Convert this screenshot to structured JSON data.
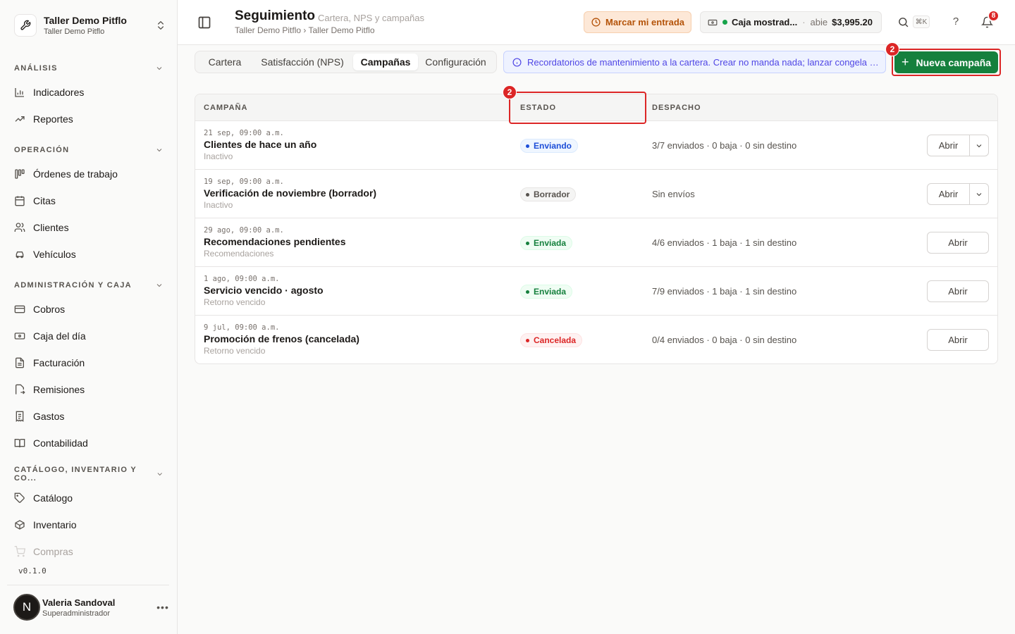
{
  "org": {
    "name": "Taller Demo Pitflo",
    "sub": "Taller Demo Pitflo"
  },
  "sidebar": {
    "sections": [
      {
        "title": "ANÁLISIS",
        "items": [
          {
            "label": "Indicadores",
            "icon": "bar-chart-icon"
          },
          {
            "label": "Reportes",
            "icon": "trend-icon"
          }
        ]
      },
      {
        "title": "OPERACIÓN",
        "items": [
          {
            "label": "Órdenes de trabajo",
            "icon": "kanban-icon"
          },
          {
            "label": "Citas",
            "icon": "calendar-icon"
          },
          {
            "label": "Clientes",
            "icon": "users-icon"
          },
          {
            "label": "Vehículos",
            "icon": "car-icon"
          }
        ]
      },
      {
        "title": "ADMINISTRACIÓN Y CAJA",
        "items": [
          {
            "label": "Cobros",
            "icon": "credit-card-icon"
          },
          {
            "label": "Caja del día",
            "icon": "banknote-icon"
          },
          {
            "label": "Facturación",
            "icon": "file-icon"
          },
          {
            "label": "Remisiones",
            "icon": "file-arrow-icon"
          },
          {
            "label": "Gastos",
            "icon": "receipt-icon"
          },
          {
            "label": "Contabilidad",
            "icon": "book-icon"
          }
        ]
      },
      {
        "title": "CATÁLOGO, INVENTARIO Y CO...",
        "items": [
          {
            "label": "Catálogo",
            "icon": "tag-icon"
          },
          {
            "label": "Inventario",
            "icon": "box-icon"
          },
          {
            "label": "Compras",
            "icon": "cart-icon"
          }
        ]
      }
    ],
    "version": "v0.1.0",
    "user": {
      "initial": "N",
      "name": "Valeria Sandoval",
      "role": "Superadministrador"
    }
  },
  "header": {
    "title": "Seguimiento",
    "subtitle": "Cartera, NPS y campañas",
    "breadcrumb": "Taller Demo Pitflo › Taller Demo Pitflo",
    "clock_in_label": "Marcar mi entrada",
    "caja": {
      "name": "Caja mostrad...",
      "separator": "·",
      "status": "abie",
      "amount": "$3,995.20"
    },
    "search_shortcut": "⌘K",
    "help": "?",
    "notifications_count": "8"
  },
  "tabs": [
    {
      "label": "Cartera",
      "active": false
    },
    {
      "label": "Satisfacción (NPS)",
      "active": false
    },
    {
      "label": "Campañas",
      "active": true
    },
    {
      "label": "Configuración",
      "active": false
    }
  ],
  "info_banner": "Recordatorios de mantenimiento a la cartera. Crear no manda nada; lanzar congela la audiencia y programa los envíos.",
  "new_campaign_label": "Nueva campaña",
  "highlights": {
    "new_button_badge": "2",
    "estado_header_badge": "2"
  },
  "table": {
    "columns": {
      "campaign": "CAMPAÑA",
      "status": "ESTADO",
      "dispatch": "DESPACHO"
    },
    "rows": [
      {
        "date": "21 sep, 09:00 a.m.",
        "name": "Clientes de hace un año",
        "sub": "Inactivo",
        "status": "Enviando",
        "status_color": "blue",
        "dispatch": "3/7 enviados · 0 baja · 0 sin destino",
        "action": "Abrir",
        "has_menu": true
      },
      {
        "date": "19 sep, 09:00 a.m.",
        "name": "Verificación de noviembre (borrador)",
        "sub": "Inactivo",
        "status": "Borrador",
        "status_color": "gray",
        "dispatch": "Sin envíos",
        "action": "Abrir",
        "has_menu": true
      },
      {
        "date": "29 ago, 09:00 a.m.",
        "name": "Recomendaciones pendientes",
        "sub": "Recomendaciones",
        "status": "Enviada",
        "status_color": "green",
        "dispatch": "4/6 enviados · 1 baja · 1 sin destino",
        "action": "Abrir",
        "has_menu": false
      },
      {
        "date": "1 ago, 09:00 a.m.",
        "name": "Servicio vencido · agosto",
        "sub": "Retorno vencido",
        "status": "Enviada",
        "status_color": "green",
        "dispatch": "7/9 enviados · 1 baja · 1 sin destino",
        "action": "Abrir",
        "has_menu": false
      },
      {
        "date": "9 jul, 09:00 a.m.",
        "name": "Promoción de frenos (cancelada)",
        "sub": "Retorno vencido",
        "status": "Cancelada",
        "status_color": "red",
        "dispatch": "0/4 enviados · 0 baja · 0 sin destino",
        "action": "Abrir",
        "has_menu": false
      }
    ]
  }
}
